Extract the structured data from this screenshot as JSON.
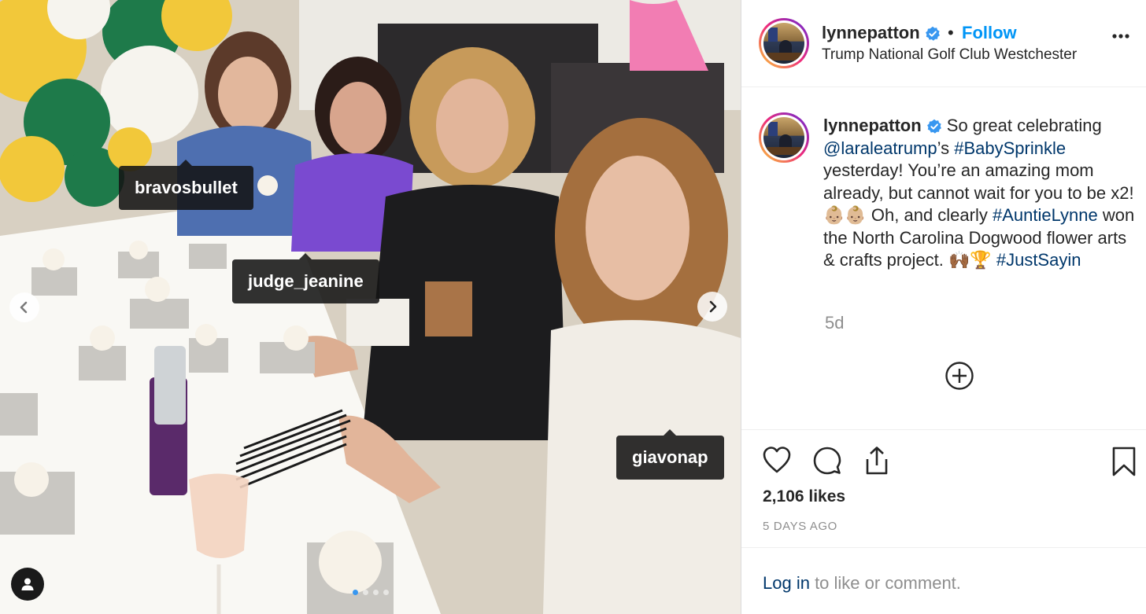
{
  "photo": {
    "tags": [
      "bravosbullet",
      "judge_jeanine",
      "giavonap"
    ],
    "carousel_dots": 4,
    "active_dot": 1
  },
  "header": {
    "username": "lynnepatton",
    "dot": "•",
    "follow_label": "Follow",
    "location": "Trump National Golf Club Westchester"
  },
  "caption": {
    "username": "lynnepatton",
    "text_1": " So great celebrating ",
    "mention": "@laraleatrump",
    "text_2": "’s ",
    "hashtag_1": "#BabySprinkle",
    "text_3": " yesterday! You’re an amazing mom already, but cannot wait for you to be x2! 👶🏼👶🏼 Oh, and clearly ",
    "hashtag_2": "#AuntieLynne",
    "text_4": " won the North Carolina Dogwood flower arts & crafts project. 🙌🏾🏆 ",
    "hashtag_3": "#JustSayin",
    "time_ago": "5d"
  },
  "stats": {
    "likes": "2,106 likes",
    "date": "5 DAYS AGO"
  },
  "footer": {
    "login_link": "Log in",
    "login_rest": " to like or comment."
  },
  "colors": {
    "link_blue": "#0095f6",
    "caption_link": "#00376b",
    "muted": "#8e8e8e",
    "verified": "#3897f0"
  },
  "icons": [
    "verified-badge-icon",
    "more-options-icon",
    "chevron-left-icon",
    "chevron-right-icon",
    "user-tag-icon",
    "add-comment-icon",
    "heart-icon",
    "comment-icon",
    "share-icon",
    "bookmark-icon"
  ]
}
